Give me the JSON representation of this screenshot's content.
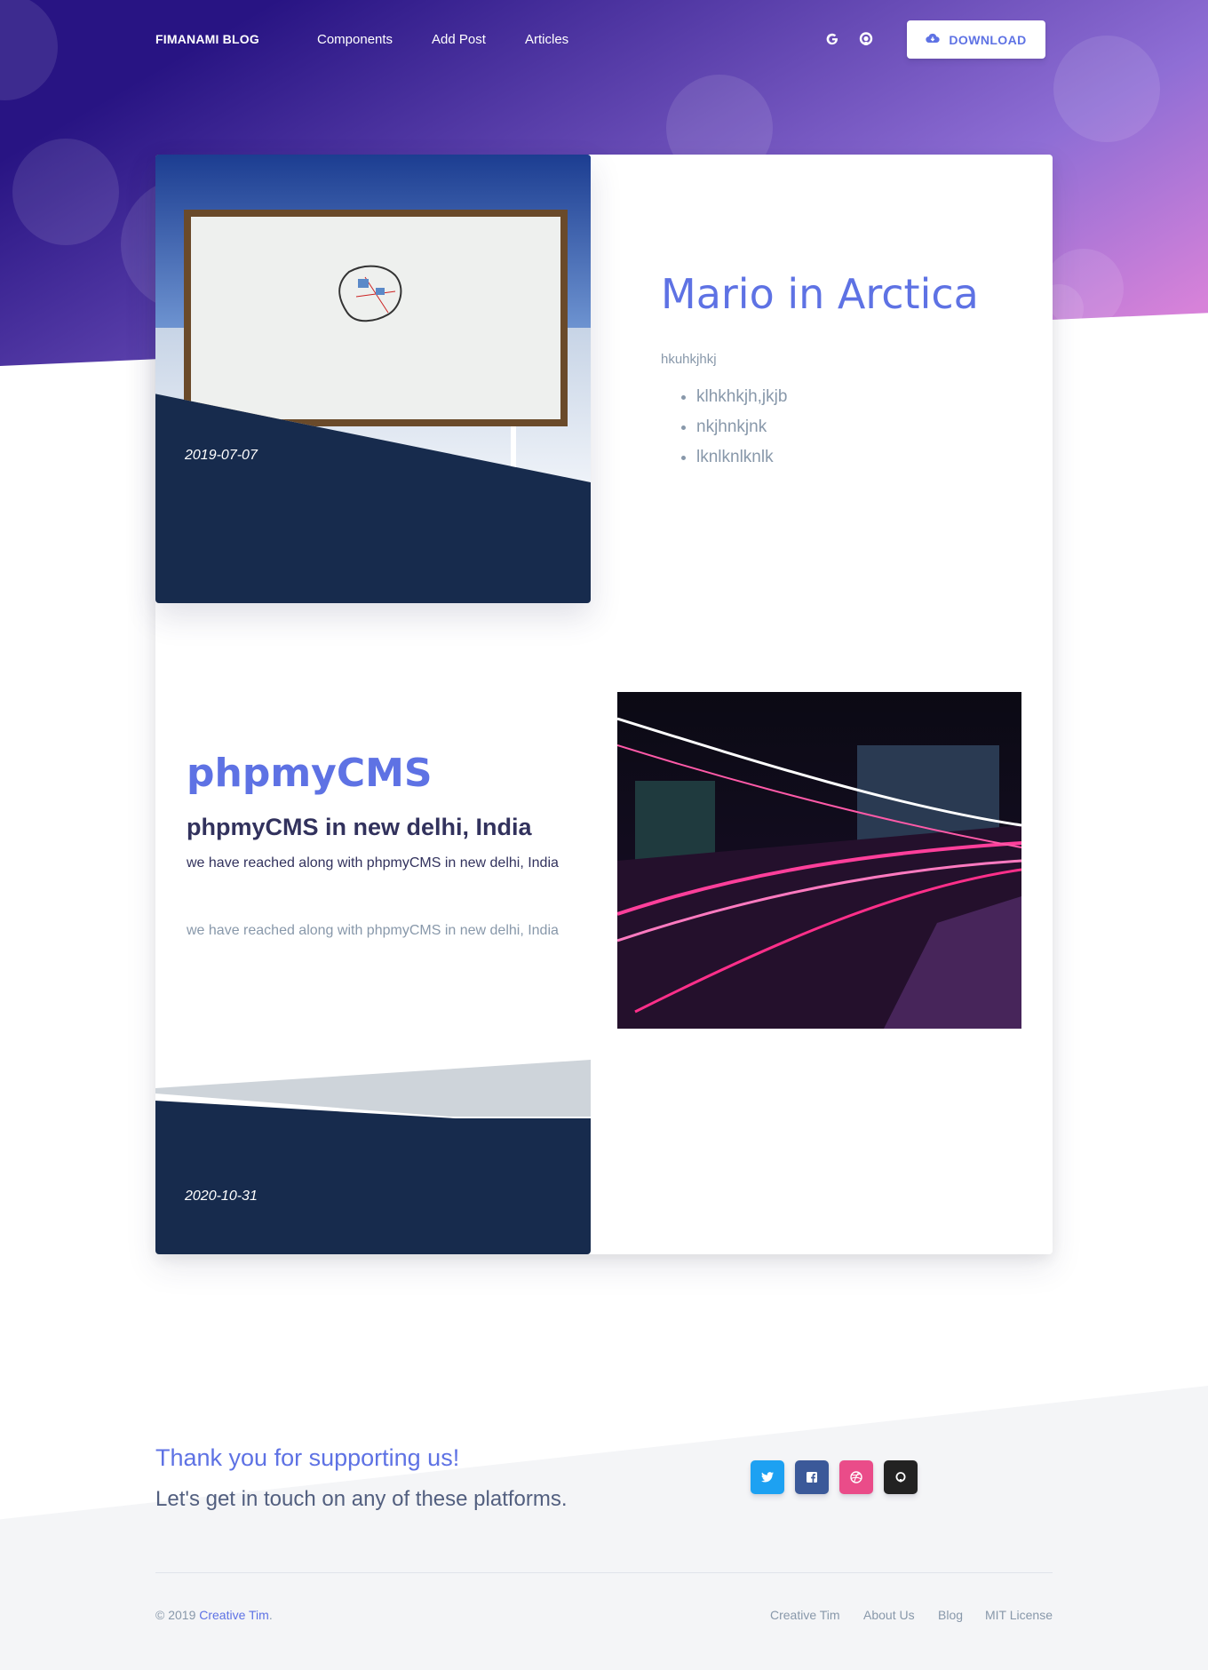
{
  "navbar": {
    "brand": "FIMANAMI BLOG",
    "links": [
      "Components",
      "Add Post",
      "Articles"
    ],
    "icons": [
      "google-icon",
      "github-icon"
    ],
    "download_label": "DOWNLOAD",
    "download_icon": "cloud-download-icon"
  },
  "posts": [
    {
      "title": "Mario in Arctica",
      "excerpt": "hkuhkjhkj",
      "bullets": [
        "klhkhkjh,jkjb",
        "nkjhnkjnk",
        "lknlknlknlk"
      ],
      "date": "2019-07-07",
      "image_desc": "Geographic South Pole sign"
    },
    {
      "title": "phpmyCMS",
      "subtitle": "phpmyCMS in new delhi, India",
      "lead": "we have reached along with phpmyCMS in new delhi, India",
      "body": "we have reached along with phpmyCMS in new delhi, India",
      "date": "2020-10-31",
      "image_desc": "City street light trails at night"
    }
  ],
  "footer": {
    "thanks": "Thank you for supporting us!",
    "contact": "Let's get in touch on any of these platforms.",
    "social": [
      {
        "icon": "twitter-icon",
        "color": "#1da1f2"
      },
      {
        "icon": "facebook-icon",
        "color": "#3b5999"
      },
      {
        "icon": "dribbble-icon",
        "color": "#ea4c89"
      },
      {
        "icon": "github-icon",
        "color": "#222222"
      }
    ],
    "copyright_prefix": "© 2019",
    "copyright_link": "Creative Tim",
    "copyright_suffix": ".",
    "links": [
      "Creative Tim",
      "About Us",
      "Blog",
      "MIT License"
    ]
  }
}
